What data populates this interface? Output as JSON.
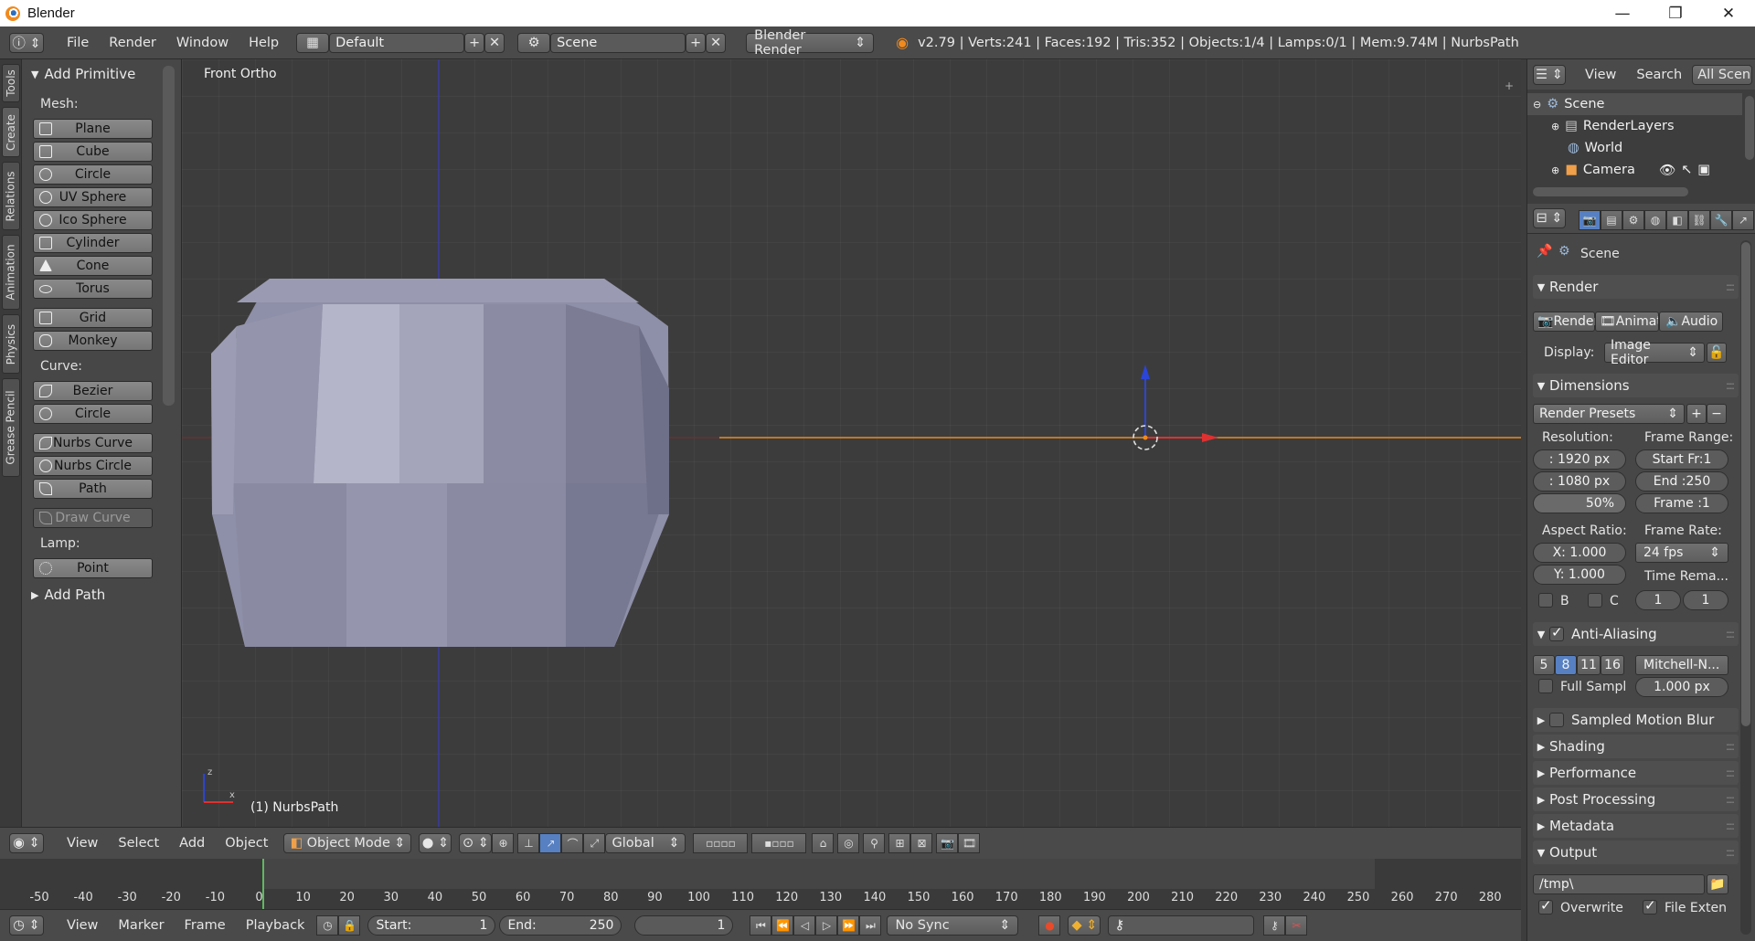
{
  "window": {
    "title": "Blender",
    "minimize": "—",
    "maximize": "❐",
    "close": "✕"
  },
  "info_header": {
    "menus": [
      "File",
      "Render",
      "Window",
      "Help"
    ],
    "screen_layout": "Default",
    "scene": "Scene",
    "engine": "Blender Render",
    "stats": "v2.79 | Verts:241 | Faces:192 | Tris:352 | Objects:1/4 | Lamps:0/1 | Mem:9.74M | NurbsPath"
  },
  "tool_tabs": [
    "Tools",
    "Create",
    "Relations",
    "Animation",
    "Physics",
    "Grease Pencil"
  ],
  "tool_shelf": {
    "panel_title": "Add Primitive",
    "mesh_label": "Mesh:",
    "mesh_items": [
      "Plane",
      "Cube",
      "Circle",
      "UV Sphere",
      "Ico Sphere",
      "Cylinder",
      "Cone",
      "Torus"
    ],
    "mesh_items2": [
      "Grid",
      "Monkey"
    ],
    "curve_label": "Curve:",
    "curve_items": [
      "Bezier",
      "Circle"
    ],
    "curve_items2": [
      "Nurbs Curve",
      "Nurbs Circle",
      "Path"
    ],
    "draw_curve": "Draw Curve",
    "lamp_label": "Lamp:",
    "lamp_items": [
      "Point"
    ],
    "add_path_panel": "Add Path"
  },
  "viewport": {
    "view_name": "Front Ortho",
    "active_object": "(1) NurbsPath",
    "axis_z": "z",
    "axis_x": "x"
  },
  "view3d_header": {
    "menus": [
      "View",
      "Select",
      "Add",
      "Object"
    ],
    "mode": "Object Mode",
    "orientation": "Global"
  },
  "timeline": {
    "ticks": [
      "-50",
      "-40",
      "-30",
      "-20",
      "-10",
      "0",
      "10",
      "20",
      "30",
      "40",
      "50",
      "60",
      "70",
      "80",
      "90",
      "100",
      "110",
      "120",
      "130",
      "140",
      "150",
      "160",
      "170",
      "180",
      "190",
      "200",
      "210",
      "220",
      "230",
      "240",
      "250",
      "260",
      "270",
      "280"
    ],
    "current_frame_marker": 0,
    "menus": [
      "View",
      "Marker",
      "Frame",
      "Playback"
    ],
    "start_label": "Start:",
    "start_value": "1",
    "end_label": "End:",
    "end_value": "250",
    "current_frame": "1",
    "sync": "No Sync"
  },
  "outliner": {
    "menus": [
      "View",
      "Search"
    ],
    "filter": "All Scenes",
    "rows": [
      "Scene",
      "RenderLayers",
      "World",
      "Camera"
    ]
  },
  "properties": {
    "context": "Scene",
    "render_panel": "Render",
    "render_buttons": [
      "Render",
      "Animation",
      "Audio"
    ],
    "display_label": "Display:",
    "display_value": "Image Editor",
    "dimensions_panel": "Dimensions",
    "render_presets": "Render Presets",
    "resolution_label": "Resolution:",
    "res_x": ": 1920 px",
    "res_y": ": 1080 px",
    "res_percent": "50%",
    "frame_range_label": "Frame Range:",
    "start_frame": "Start Fr:1",
    "end_frame": "End :250",
    "frame": "Frame :1",
    "aspect_label": "Aspect Ratio:",
    "aspect_x": "X:  1.000",
    "aspect_y": "Y:  1.000",
    "frame_rate_label": "Frame Rate:",
    "frame_rate": "24 fps",
    "time_remap_label": "Time Rema...",
    "remap_old": "1",
    "remap_new": "1",
    "border_b": "B",
    "border_c": "C",
    "aa_panel": "Anti-Aliasing",
    "aa_samples": [
      "5",
      "8",
      "11",
      "16"
    ],
    "aa_active": "8",
    "aa_filter": "Mitchell-N...",
    "full_sample": "Full Sampl",
    "filter_size": "1.000 px",
    "collapsed_panels": [
      "Sampled Motion Blur",
      "Shading",
      "Performance",
      "Post Processing",
      "Metadata"
    ],
    "output_panel": "Output",
    "output_path": "/tmp\\",
    "overwrite": "Overwrite",
    "file_extensions": "File Exten"
  },
  "colors": {
    "accent_blue": "#5680c2",
    "x_axis": "#e03030",
    "active_orange": "#f08a1e",
    "mesh": "#8e8fa8"
  }
}
